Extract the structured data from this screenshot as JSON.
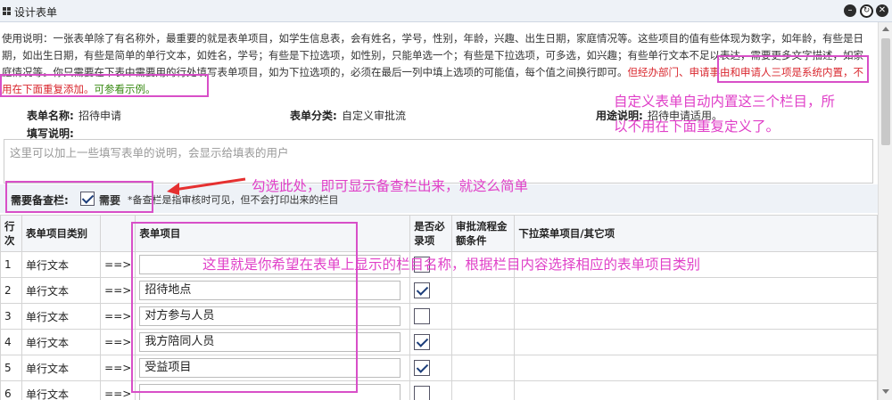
{
  "window": {
    "title": "设计表单",
    "buttons": [
      "close-icon",
      "refresh-icon",
      "minimize-icon"
    ]
  },
  "instructions": {
    "text": "使用说明：一张表单除了有名称外，最重要的就是表单项目，如学生信息表，会有姓名，学号，性别，年龄，兴趣、出生日期，家庭情况等。这些项目的值有些体现为数字，如年龄，有些是日期，如出生日期，有些是简单的单行文本，如姓名，学号；有些是下拉选项，如性别，只能单选一个；有些是下拉选项，可多选，如兴趣；有些单行文本不足以表达，需要更多文字描述，如家庭情况等。你只需要在下表中需要用的行处填写表单项目，如为下拉选项的，必须在最后一列中填上选项的可能值，每个值之间换行即可。",
    "red_text": "但经办部门、申请事由和申请人三项是系统内置，不用在下面重复添加。",
    "link_text": "可参看示例。"
  },
  "form": {
    "name_label": "表单名称:",
    "name_value": "招待申请",
    "category_label": "表单分类:",
    "category_value": "自定义审批流",
    "usage_label": "用途说明:",
    "usage_value": "招待申请适用。",
    "fill_label": "填写说明:",
    "fill_placeholder": "这里可以加上一些填写表单的说明，会显示给填表的用户"
  },
  "backup": {
    "label": "需要备查栏:",
    "checked": true,
    "checkbox_label": "需要",
    "note": "*备查栏是指审核时可见，但不会打印出来的栏目"
  },
  "table": {
    "headers": [
      "行次",
      "表单项目类别",
      "",
      "表单项目",
      "是否必录项",
      "审批流程金额条件",
      "下拉菜单项目/其它项"
    ],
    "rows": [
      {
        "num": "1",
        "type": "单行文本",
        "arrow": "==>",
        "item": "",
        "required": false
      },
      {
        "num": "2",
        "type": "单行文本",
        "arrow": "==>",
        "item": "招待地点",
        "required": true
      },
      {
        "num": "3",
        "type": "单行文本",
        "arrow": "==>",
        "item": "对方参与人员",
        "required": false
      },
      {
        "num": "4",
        "type": "单行文本",
        "arrow": "==>",
        "item": "我方陪同人员",
        "required": true
      },
      {
        "num": "5",
        "type": "单行文本",
        "arrow": "==>",
        "item": "受益项目",
        "required": true
      },
      {
        "num": "6",
        "type": "单行文本",
        "arrow": "==>",
        "item": "",
        "required": false
      }
    ]
  },
  "annotations": {
    "a1_line1": "自定义表单自动内置这三个栏目，所",
    "a1_line2": "以不用在下面重复定义了。",
    "a2": "勾选此处，即可显示备查栏出来，就这么简单",
    "a3": "这里就是你希望在表单上显示的栏目名称，根据栏目内容选择相应的表单项目类别",
    "color": "#e040c8"
  }
}
